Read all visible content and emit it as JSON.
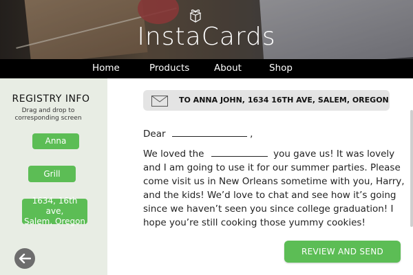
{
  "brand": {
    "name": "InstaCards"
  },
  "nav": {
    "items": [
      "Home",
      "Products",
      "About",
      "Shop"
    ]
  },
  "sidebar": {
    "title": "REGISTRY INFO",
    "subtitle_line1": "Drag and drop to",
    "subtitle_line2": "corresponding screen",
    "chips": [
      "Anna",
      "Grill",
      "1634, 16th ave,",
      "Salem, Oregon"
    ]
  },
  "address": {
    "text": "TO ANNA JOHN, 1634 16TH AVE, SALEM, OREGON"
  },
  "letter": {
    "salutation": "Dear",
    "salutation_end": ",",
    "line1_start": "We loved the",
    "line1_end": "you gave us! It was lovely",
    "line2": "and I am going to use it for our summer parties. Please",
    "line3": "come visit us in New Orleans sometime with you, Harry,",
    "line4": "and the kids! We’d love to chat and see how it’s going",
    "line5": "since we haven’t seen you since college graduation! I",
    "line6": "hope you’re still cooking those yummy cookies!"
  },
  "actions": {
    "review_label": "REVIEW AND SEND"
  },
  "colors": {
    "accent": "#5cbd55",
    "nav_bg": "#000000",
    "sidebar_bg": "#e8ede4",
    "address_bg": "#e4e4e4"
  },
  "icons": {
    "logo": "gift-box-icon",
    "address": "envelope-icon",
    "back": "back-arrow-icon"
  }
}
